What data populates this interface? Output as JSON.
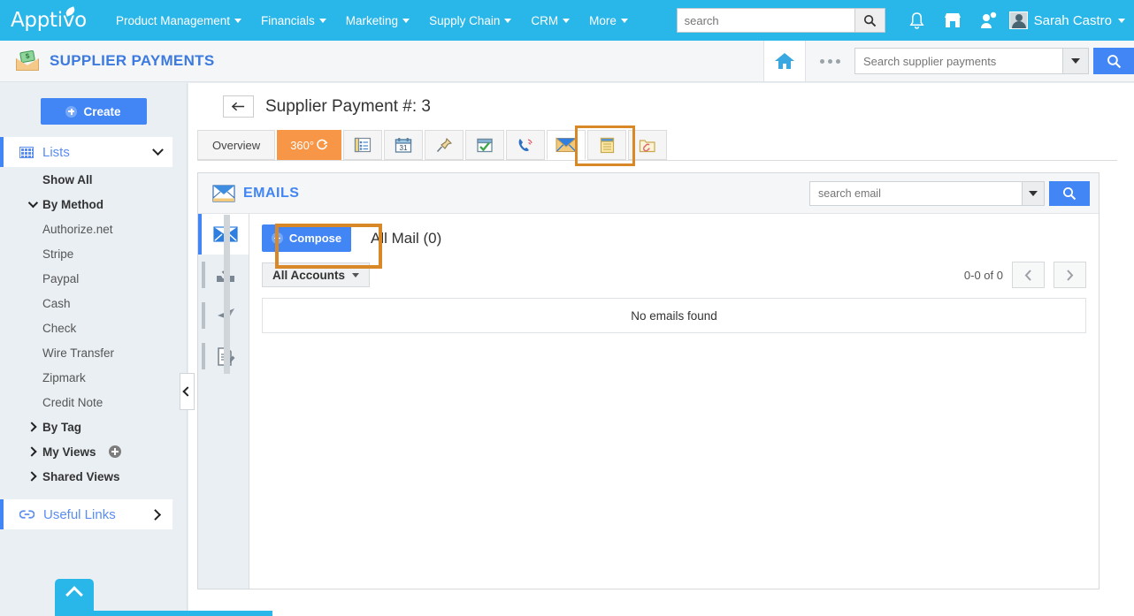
{
  "topnav": {
    "logo": "Apptivo",
    "menu": [
      {
        "label": "Product Management",
        "icon": "chevron-down-icon"
      },
      {
        "label": "Financials",
        "icon": "chevron-down-icon"
      },
      {
        "label": "Marketing",
        "icon": "chevron-down-icon"
      },
      {
        "label": "Supply Chain",
        "icon": "chevron-down-icon"
      },
      {
        "label": "CRM",
        "icon": "chevron-down-icon"
      },
      {
        "label": "More",
        "icon": "chevron-down-icon"
      }
    ],
    "search_placeholder": "search",
    "search_value": "",
    "search_icon": "search-icon",
    "icons": [
      "bell-icon",
      "store-icon",
      "user-add-icon"
    ],
    "user_name": "Sarah Castro",
    "avatar": "avatar-icon"
  },
  "appheader": {
    "icon": "money-envelope-icon",
    "title": "SUPPLIER PAYMENTS",
    "home_icon": "home-icon",
    "more_icon": "ellipsis-icon",
    "search_placeholder": "Search supplier payments",
    "search_value": "",
    "dropdown_icon": "chevron-down-icon",
    "search_button_icon": "search-icon"
  },
  "sidebar": {
    "create_label": "Create",
    "create_icon": "plus-circle-icon",
    "lists_label": "Lists",
    "lists_icon": "grid-icon",
    "lists_chevron": "chevron-down-icon",
    "items": [
      {
        "label": "Show All",
        "type": "bold"
      },
      {
        "label": "By Method",
        "type": "group",
        "icon": "chevron-down-icon"
      },
      {
        "label": "Authorize.net",
        "type": "leaf"
      },
      {
        "label": "Stripe",
        "type": "leaf"
      },
      {
        "label": "Paypal",
        "type": "leaf"
      },
      {
        "label": "Cash",
        "type": "leaf"
      },
      {
        "label": "Check",
        "type": "leaf"
      },
      {
        "label": "Wire Transfer",
        "type": "leaf"
      },
      {
        "label": "Zipmark",
        "type": "leaf"
      },
      {
        "label": "Credit Note",
        "type": "leaf"
      },
      {
        "label": "By Tag",
        "type": "group",
        "icon": "chevron-right-icon"
      },
      {
        "label": "My Views",
        "type": "group",
        "icon": "chevron-right-icon",
        "add": "plus-icon"
      },
      {
        "label": "Shared Views",
        "type": "group",
        "icon": "chevron-right-icon"
      }
    ],
    "useful_links_label": "Useful Links",
    "useful_links_icon": "link-icon",
    "useful_links_chevron": "chevron-right-icon",
    "collapse_icon": "chevron-left-icon",
    "scroll_top_icon": "chevron-up-icon"
  },
  "main": {
    "back_icon": "arrow-left-icon",
    "page_title": "Supplier Payment #: 3",
    "tabs": [
      {
        "label": "Overview",
        "name": "tab-overview",
        "style": "first"
      },
      {
        "label": "360°",
        "name": "tab-360",
        "style": "active360",
        "icon": "refresh-icon"
      },
      {
        "label": "",
        "name": "tab-details",
        "icon": "details-icon"
      },
      {
        "label": "",
        "name": "tab-calendar",
        "icon": "calendar-icon"
      },
      {
        "label": "",
        "name": "tab-pin",
        "icon": "pin-icon"
      },
      {
        "label": "",
        "name": "tab-tasks",
        "icon": "task-check-icon"
      },
      {
        "label": "",
        "name": "tab-calls",
        "icon": "phone-icon"
      },
      {
        "label": "",
        "name": "tab-emails",
        "icon": "envelope-icon",
        "selected": true
      },
      {
        "label": "",
        "name": "tab-notes",
        "icon": "notes-icon"
      },
      {
        "label": "",
        "name": "tab-documents",
        "icon": "attachment-folder-icon"
      }
    ],
    "highlight_color": "#d98828"
  },
  "emails": {
    "panel_icon": "envelope-icon",
    "panel_title": "EMAILS",
    "search_placeholder": "search email",
    "search_value": "",
    "search_dropdown_icon": "chevron-down-icon",
    "search_button_icon": "search-icon",
    "mailnav": [
      {
        "name": "mailnav-inbox",
        "icon": "envelope-icon",
        "active": true
      },
      {
        "name": "mailnav-archive",
        "icon": "inbox-download-icon",
        "active": false
      },
      {
        "name": "mailnav-sent",
        "icon": "paper-plane-icon",
        "active": false
      },
      {
        "name": "mailnav-drafts",
        "icon": "draft-pencil-icon",
        "active": false
      }
    ],
    "compose_label": "Compose",
    "compose_icon": "plus-circle-icon",
    "all_mail_label": "All Mail (0)",
    "accounts_label": "All Accounts",
    "accounts_icon": "caret-down-icon",
    "page_count": "0-0 of 0",
    "prev_icon": "chevron-left-icon",
    "next_icon": "chevron-right-icon",
    "empty_message": "No emails found"
  },
  "colors": {
    "brand_blue": "#29b6e8",
    "accent_blue": "#4285f4",
    "highlight_orange": "#d98828",
    "tab_orange": "#f79646",
    "sidebar_bg": "#eaeff3"
  }
}
